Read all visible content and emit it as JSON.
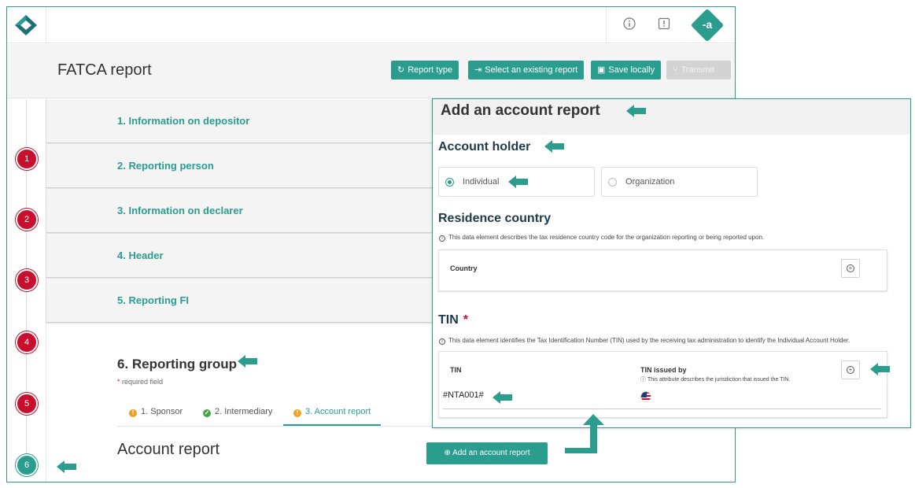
{
  "app": {
    "avatar_text": "-a",
    "page_title": "FATCA report",
    "header_buttons": {
      "report_type": "Report type",
      "select_existing": "Select an existing report",
      "save_locally": "Save locally",
      "transmit": "Transmit"
    }
  },
  "stepper": [
    "1",
    "2",
    "3",
    "4",
    "5",
    "6"
  ],
  "sections": [
    "1. Information on depositor",
    "2. Reporting person",
    "3. Information on declarer",
    "4. Header",
    "5. Reporting FI"
  ],
  "group": {
    "title": "6. Reporting group",
    "required_star": "*",
    "required_text": "required field",
    "tabs": {
      "sponsor": "1. Sponsor",
      "intermediary": "2. Intermediary",
      "account_report": "3. Account report"
    },
    "account_report_title": "Account report",
    "add_button": "Add an account report"
  },
  "panel": {
    "title": "Add an account report",
    "account_holder": {
      "heading": "Account holder",
      "option_individual": "Individual",
      "option_organization": "Organization",
      "selected": "Individual"
    },
    "residence": {
      "heading": "Residence country",
      "info": "This data element describes the tax residence country code for the organization reporting or being reported upon.",
      "field_label": "Country"
    },
    "tin": {
      "heading": "TIN",
      "required_star": "*",
      "info": "This data element identifies the Tax Identification Number (TIN) used by the receiving tax administration to identify the Individual Account Holder.",
      "field_label": "TIN",
      "value": "#NTA001#",
      "issued_by_label": "TIN issued by",
      "issued_by_info": "This attribute describes the jurisdiction that issued the TIN."
    }
  },
  "colors": {
    "accent": "#2a9d8f",
    "step_red": "#c8102e",
    "warn": "#f0a020",
    "ok": "#3fa648"
  }
}
